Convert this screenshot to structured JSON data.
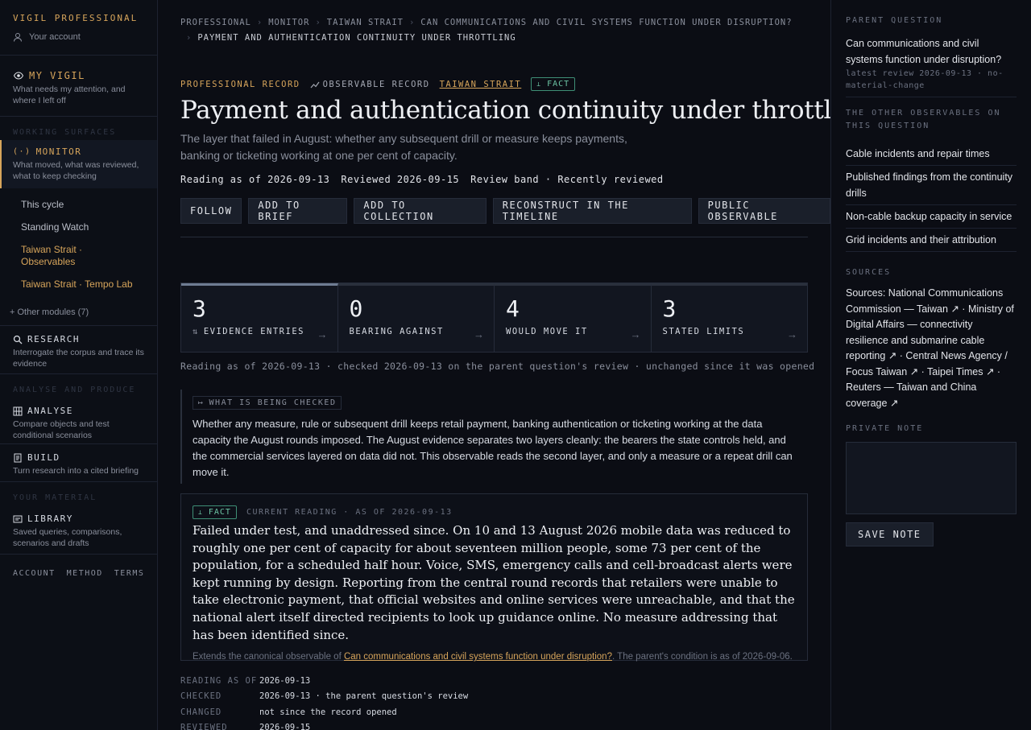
{
  "sidebar": {
    "brand": "VIGIL PROFESSIONAL",
    "account": "Your account",
    "my_vigil": {
      "title": "MY VIGIL",
      "sub": "What needs my attention, and where I left off"
    },
    "section_working": "WORKING SURFACES",
    "monitor": {
      "title": "MONITOR",
      "sub": "What moved, what was reviewed, what to keep checking"
    },
    "links": [
      "This cycle",
      "Standing Watch",
      "Taiwan Strait · Observables",
      "Taiwan Strait · Tempo Lab"
    ],
    "other_modules": "+ Other modules (7)",
    "research": {
      "title": "RESEARCH",
      "sub": "Interrogate the corpus and trace its evidence"
    },
    "section_analyse": "ANALYSE AND PRODUCE",
    "analyse": {
      "title": "ANALYSE",
      "sub": "Compare objects and test conditional scenarios"
    },
    "build": {
      "title": "BUILD",
      "sub": "Turn research into a cited briefing"
    },
    "section_material": "YOUR MATERIAL",
    "library": {
      "title": "LIBRARY",
      "sub": "Saved queries, comparisons, scenarios and drafts"
    },
    "footer": [
      "ACCOUNT",
      "METHOD",
      "TERMS"
    ]
  },
  "breadcrumb": {
    "items": [
      "PROFESSIONAL",
      "MONITOR",
      "TAIWAN STRAIT",
      "CAN COMMUNICATIONS AND CIVIL SYSTEMS FUNCTION UNDER DISRUPTION?"
    ],
    "current": "PAYMENT AND AUTHENTICATION CONTINUITY UNDER THROTTLING"
  },
  "record": {
    "kind": "PROFESSIONAL RECORD",
    "observable": "OBSERVABLE RECORD",
    "topic": "TAIWAN STRAIT",
    "fact": "FACT",
    "title": "Payment and authentication continuity under throttling",
    "lede": "The layer that failed in August: whether any subsequent drill or measure keeps payments, banking or ticketing working at one per cent of capacity.",
    "reading_as_of": "Reading as of 2026-09-13",
    "reviewed": "Reviewed 2026-09-15",
    "band": "Review band · Recently reviewed"
  },
  "actions": [
    "FOLLOW",
    "ADD TO BRIEF",
    "ADD TO COLLECTION",
    "RECONSTRUCT IN THE TIMELINE",
    "PUBLIC OBSERVABLE"
  ],
  "stats": [
    {
      "num": "3",
      "label": "EVIDENCE ENTRIES"
    },
    {
      "num": "0",
      "label": "BEARING AGAINST"
    },
    {
      "num": "4",
      "label": "WOULD MOVE IT"
    },
    {
      "num": "3",
      "label": "STATED LIMITS"
    }
  ],
  "stat_note": "Reading as of 2026-09-13 · checked 2026-09-13 on the parent question's review · unchanged since it was opened",
  "checked": {
    "tag": "WHAT IS BEING CHECKED",
    "text": "Whether any measure, rule or subsequent drill keeps retail payment, banking authentication or ticketing working at the data capacity the August rounds imposed. The August evidence separates two layers cleanly: the bearers the state controls held, and the commercial services layered on data did not. This observable reads the second layer, and only a measure or a repeat drill can move it."
  },
  "current": {
    "fact": "FACT",
    "label": "CURRENT READING · AS OF 2026-09-13",
    "body": "Failed under test, and unaddressed since. On 10 and 13 August 2026 mobile data was reduced to roughly one per cent of capacity for about seventeen million people, some 73 per cent of the population, for a scheduled half hour. Voice, SMS, emergency calls and cell-broadcast alerts were kept running by design. Reporting from the central round records that retailers were unable to take electronic payment, that official websites and online services were unreachable, and that the national alert itself directed recipients to look up guidance online. No measure addressing that has been identified since.",
    "ext_pre": "Extends the canonical observable of ",
    "ext_link": "Can communications and civil systems function under disruption?",
    "ext_post": ". The parent's condition is as of 2026-09-06."
  },
  "kv": [
    {
      "k": "READING AS OF",
      "v": "2026-09-13"
    },
    {
      "k": "CHECKED",
      "v": "2026-09-13 · the parent question's review"
    },
    {
      "k": "CHANGED",
      "v": "not since the record opened"
    },
    {
      "k": "REVIEWED",
      "v": "2026-09-15"
    }
  ],
  "right": {
    "parent_h": "PARENT QUESTION",
    "parent_q": "Can communications and civil systems function under disruption?",
    "parent_meta": "latest review 2026-09-13 · no-material-change",
    "others_h": "THE OTHER OBSERVABLES ON THIS QUESTION",
    "others": [
      "Cable incidents and repair times",
      "Published findings from the continuity drills",
      "Non-cable backup capacity in service",
      "Grid incidents and their attribution"
    ],
    "sources_h": "SOURCES",
    "sources": "Sources: National Communications Commission — Taiwan ↗ · Ministry of Digital Affairs — connectivity resilience and submarine cable reporting ↗ · Central News Agency / Focus Taiwan ↗ · Taipei Times ↗ · Reuters — Taiwan and China coverage ↗",
    "note_h": "PRIVATE NOTE",
    "save": "SAVE NOTE"
  }
}
